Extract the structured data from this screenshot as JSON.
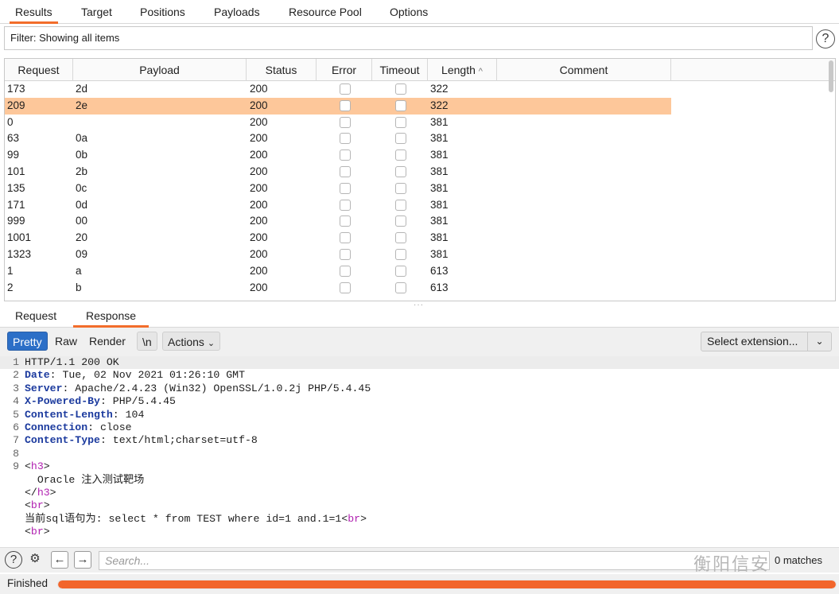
{
  "tabs": [
    "Results",
    "Target",
    "Positions",
    "Payloads",
    "Resource Pool",
    "Options"
  ],
  "filter": "Filter: Showing all items",
  "help_glyph": "?",
  "table": {
    "columns": [
      "Request",
      "Payload",
      "Status",
      "Error",
      "Timeout",
      "Length",
      "Comment"
    ],
    "sort_glyph": "^",
    "rows": [
      {
        "request": "173",
        "payload": "2d",
        "status": "200",
        "length": "322",
        "selected": false
      },
      {
        "request": "209",
        "payload": "2e",
        "status": "200",
        "length": "322",
        "selected": true
      },
      {
        "request": "0",
        "payload": "",
        "status": "200",
        "length": "381",
        "selected": false
      },
      {
        "request": "63",
        "payload": "0a",
        "status": "200",
        "length": "381",
        "selected": false
      },
      {
        "request": "99",
        "payload": "0b",
        "status": "200",
        "length": "381",
        "selected": false
      },
      {
        "request": "101",
        "payload": "2b",
        "status": "200",
        "length": "381",
        "selected": false
      },
      {
        "request": "135",
        "payload": "0c",
        "status": "200",
        "length": "381",
        "selected": false
      },
      {
        "request": "171",
        "payload": "0d",
        "status": "200",
        "length": "381",
        "selected": false
      },
      {
        "request": "999",
        "payload": "00",
        "status": "200",
        "length": "381",
        "selected": false
      },
      {
        "request": "1001",
        "payload": "20",
        "status": "200",
        "length": "381",
        "selected": false
      },
      {
        "request": "1323",
        "payload": "09",
        "status": "200",
        "length": "381",
        "selected": false
      },
      {
        "request": "1",
        "payload": "a",
        "status": "200",
        "length": "613",
        "selected": false
      },
      {
        "request": "2",
        "payload": "b",
        "status": "200",
        "length": "613",
        "selected": false
      }
    ]
  },
  "detail_tabs": [
    "Request",
    "Response"
  ],
  "toolbar": {
    "pretty": "Pretty",
    "raw": "Raw",
    "render": "Render",
    "newline": "\\n",
    "actions": "Actions",
    "select_extension": "Select extension..."
  },
  "response_lines": [
    {
      "n": "1",
      "text": "HTTP/1.1 200 OK"
    },
    {
      "n": "2",
      "key": "Date",
      "text": ": Tue, 02 Nov 2021 01:26:10 GMT"
    },
    {
      "n": "3",
      "key": "Server",
      "text": ": Apache/2.4.23 (Win32) OpenSSL/1.0.2j PHP/5.4.45"
    },
    {
      "n": "4",
      "key": "X-Powered-By",
      "text": ": PHP/5.4.45"
    },
    {
      "n": "5",
      "key": "Content-Length",
      "text": ": 104"
    },
    {
      "n": "6",
      "key": "Connection",
      "text": ": close"
    },
    {
      "n": "7",
      "key": "Content-Type",
      "text": ": text/html;charset=utf-8"
    },
    {
      "n": "8",
      "text": ""
    },
    {
      "n": "9",
      "pre": "<",
      "tag": "h3",
      "post": ">"
    },
    {
      "n": "",
      "text": "  Oracle 注入测试靶场"
    },
    {
      "n": "",
      "pre": "</",
      "tag": "h3",
      "post": ">"
    },
    {
      "n": "",
      "pre": "<",
      "tag": "br",
      "post": ">"
    },
    {
      "n": "",
      "text": "当前sql语句为: select * from TEST where id=1 and.1=1",
      "pre": "<",
      "tag": "br",
      "post": ">"
    },
    {
      "n": "",
      "pre": "<",
      "tag": "br",
      "post": ">"
    }
  ],
  "search": {
    "placeholder": "Search...",
    "matches": "0 matches"
  },
  "watermark": "衡阳信安",
  "status": {
    "label": "Finished",
    "progress": 1.0
  },
  "colors": {
    "accent": "#f26d2b",
    "selected_row": "#fdc79a",
    "header_key": "#1b3a9e",
    "tag": "#b020b0",
    "button_on": "#2c6fc7"
  }
}
